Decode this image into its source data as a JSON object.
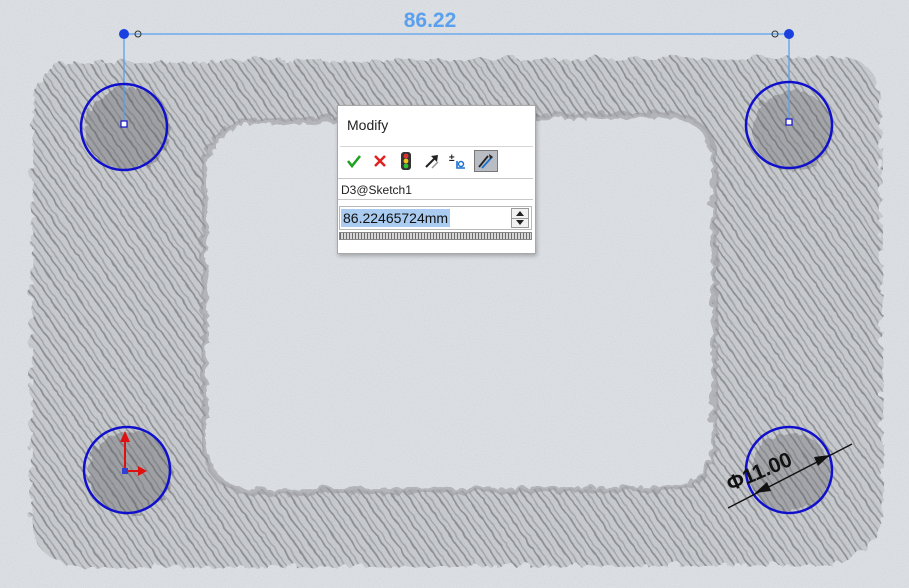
{
  "sketch": {
    "horizontal_dimension": "86.22",
    "diameter_dimension": "Φ11.00"
  },
  "modify_dialog": {
    "title": "Modify",
    "toolbar": {
      "ok": "check-icon",
      "cancel": "cancel-icon",
      "rebuild": "traffic-light-icon",
      "reverse": "reverse-arrow-icon",
      "mark_for_drawing": "mark-dimension-icon",
      "selected": "mark-dimension-for-drawing-icon"
    },
    "dimension_name": "D3@Sketch1",
    "value": "86.22465724mm"
  },
  "colors": {
    "dimension_blue": "#5aa0ee",
    "circle_blue": "#1010cc",
    "origin_red": "#e01010"
  }
}
